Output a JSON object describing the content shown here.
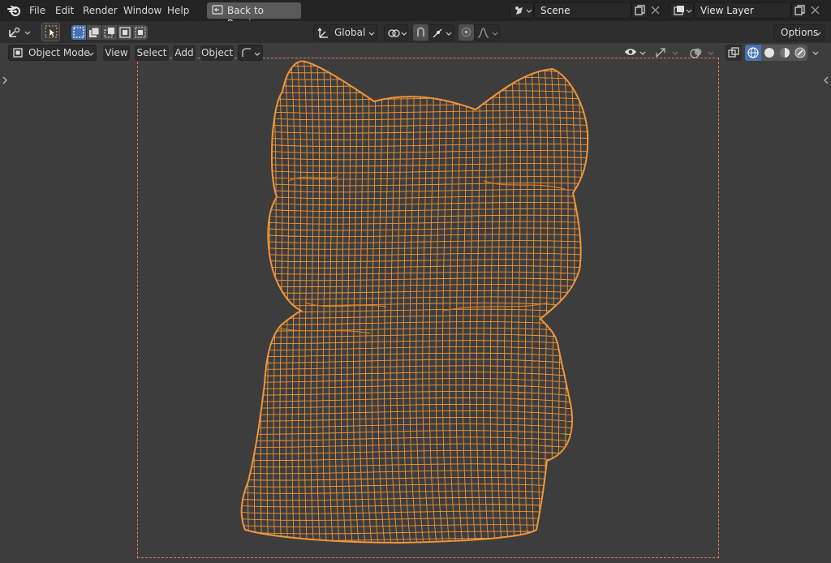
{
  "topbar": {
    "menu": [
      "File",
      "Edit",
      "Render",
      "Window",
      "Help"
    ],
    "back_button": "Back to Previous",
    "scene_name": "Scene",
    "view_layer_name": "View Layer"
  },
  "toolbar": {
    "transform_orientation": "Global",
    "options_label": "Options"
  },
  "header": {
    "mode": "Object Mode",
    "menus": [
      "View",
      "Select",
      "Add",
      "Object"
    ]
  },
  "viewport": {
    "shading": "wireframe",
    "mesh_color": "#f0953a",
    "frame_color": "#e07b5a",
    "background": "#3d3d3d"
  },
  "icons": [
    "blender-logo-icon",
    "back-icon",
    "scene-icon",
    "view-layer-icon",
    "copy-icon",
    "close-icon",
    "select-tool-icon",
    "snap-icon",
    "proportional-edit-icon",
    "visibility-icon",
    "gizmo-icon",
    "overlay-icon",
    "xray-icon",
    "wireframe-shading-icon",
    "solid-shading-icon",
    "material-shading-icon",
    "rendered-shading-icon"
  ]
}
